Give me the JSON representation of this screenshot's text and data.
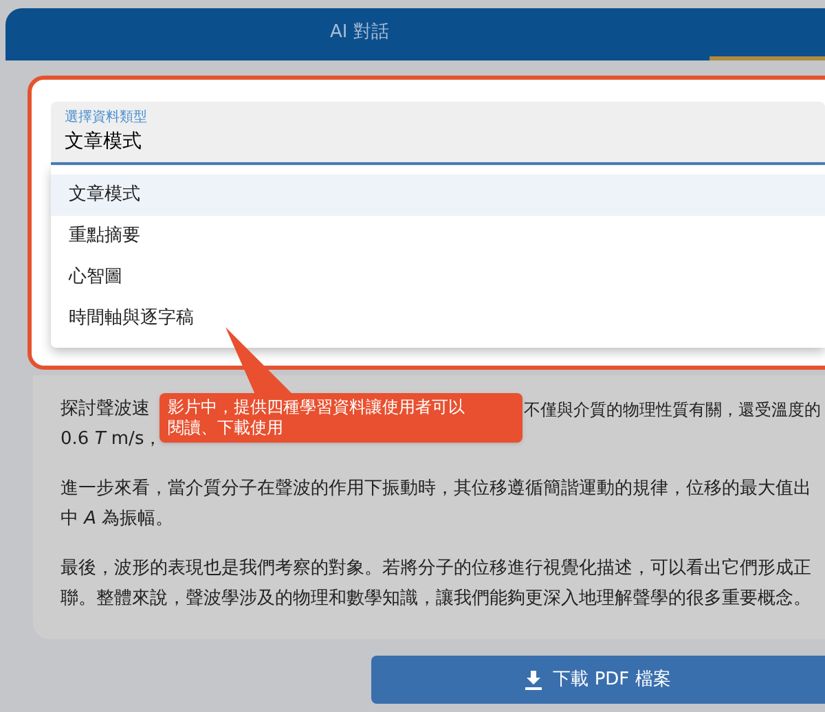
{
  "tabs": [
    {
      "label": "AI 對話",
      "selected": false
    }
  ],
  "select": {
    "label": "選擇資料類型",
    "value": "文章模式",
    "expanded": true,
    "options": [
      {
        "label": "文章模式",
        "selected": true
      },
      {
        "label": "重點摘要",
        "selected": false
      },
      {
        "label": "心智圖",
        "selected": false
      },
      {
        "label": "時間軸與逐字稿",
        "selected": false
      }
    ]
  },
  "callout": {
    "text": "影片中，提供四種學習資料讓使用者可以閱讀、下載使用"
  },
  "paragraphs": [
    {
      "lines": [
        {
          "left": "探討聲波速",
          "right": "不僅與介質的物理性質有關，還受溫度的"
        },
        {
          "left": "0.6 *T* m/s，"
        }
      ]
    },
    {
      "lines": [
        {
          "left": "進一步來看，當介質分子在聲波的作用下振動時，其位移遵循簡諧運動的規律，位移的最大值出"
        },
        {
          "left": "中 *A* 為振幅。"
        }
      ]
    },
    {
      "lines": [
        {
          "left": "最後，波形的表現也是我們考察的對象。若將分子的位移進行視覺化描述，可以看出它們形成正"
        },
        {
          "left": "聯。整體來說，聲波學涉及的物理和數學知識，讓我們能夠更深入地理解聲學的很多重要概念。"
        }
      ]
    }
  ],
  "download_button": {
    "label": "下載 PDF 檔案"
  }
}
